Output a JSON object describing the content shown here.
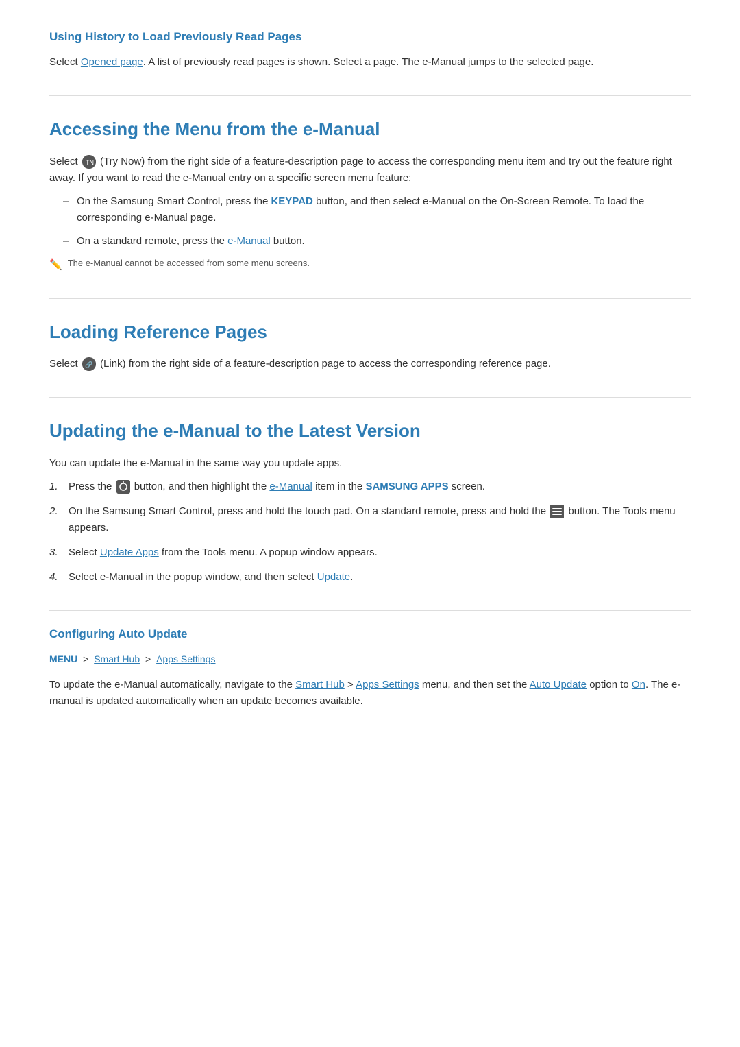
{
  "sections": {
    "history_section": {
      "title": "Using History to Load Previously Read Pages",
      "body": "Select  Opened page. A list of previously read pages is shown. Select a page. The e-Manual jumps to the selected page.",
      "opened_page_link": "Opened page"
    },
    "accessing_menu": {
      "title": "Accessing the Menu from the e-Manual",
      "intro": "Select  (Try Now) from the right side of a feature-description page to access the corresponding menu item and try out the feature right away. If you want to read the e-Manual entry on a specific screen menu feature:",
      "bullets": [
        {
          "text_before": "On the Samsung Smart Control, press the ",
          "highlight": "KEYPAD",
          "text_after": " button, and then select e-Manual on the On-Screen Remote. To load the corresponding e-Manual page."
        },
        {
          "text_before": "On a standard remote, press the ",
          "highlight": "e-Manual",
          "text_after": " button."
        }
      ],
      "note": "The e-Manual cannot be accessed from some menu screens."
    },
    "loading_reference": {
      "title": "Loading Reference Pages",
      "body_before": "Select ",
      "body_after": " (Link) from the right side of a feature-description page to access the corresponding reference page."
    },
    "updating_emanual": {
      "title": "Updating the e-Manual to the Latest Version",
      "intro": "You can update the e-Manual in the same way you update apps.",
      "steps": [
        {
          "num": "1.",
          "text_before": "Press the ",
          "highlight1": "",
          "text_mid": " button, and then highlight the ",
          "highlight2": "e-Manual",
          "text_mid2": " item in the ",
          "highlight3": "SAMSUNG APPS",
          "text_after": " screen."
        },
        {
          "num": "2.",
          "text": "On the Samsung Smart Control, press and hold the touch pad. On a standard remote, press and hold the ",
          "icon": "tools",
          "text_after": " button. The Tools menu appears."
        },
        {
          "num": "3.",
          "text_before": "Select ",
          "highlight": "Update Apps",
          "text_after": " from the Tools menu. A popup window appears."
        },
        {
          "num": "4.",
          "text_before": "Select e-Manual in the popup window, and then select ",
          "highlight": "Update",
          "text_after": "."
        }
      ]
    },
    "configuring_auto": {
      "title": "Configuring Auto Update",
      "breadcrumb": {
        "menu": "MENU",
        "arrow1": ">",
        "smart_hub": "Smart Hub",
        "arrow2": ">",
        "apps_settings": "Apps Settings"
      },
      "body_before": "To update the e-Manual automatically, navigate to the ",
      "highlight1": "Smart Hub",
      "arrow": " > ",
      "highlight2": "Apps Settings",
      "body_mid": " menu, and then set the ",
      "highlight3": "Auto Update",
      "body_mid2": " option to ",
      "highlight4": "On",
      "body_after": ". The e-manual is updated automatically when an update becomes available."
    }
  }
}
